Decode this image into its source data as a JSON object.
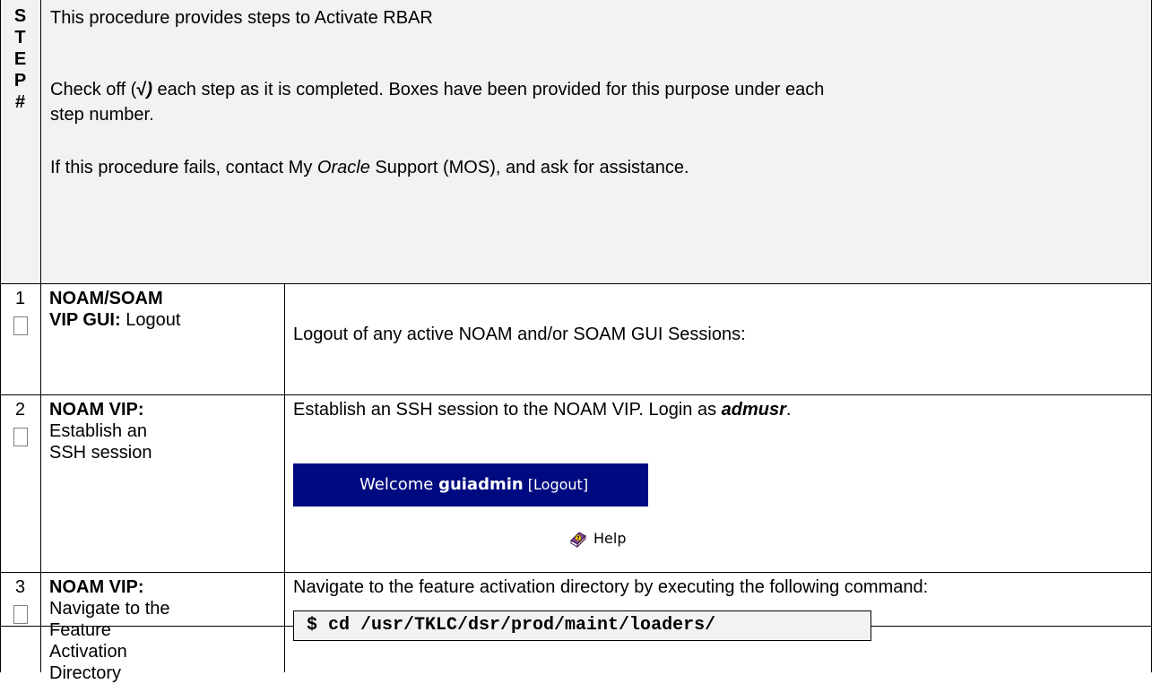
{
  "header": {
    "step_label": [
      "S",
      "T",
      "E",
      "P",
      "#"
    ],
    "intro": "This procedure provides steps to Activate RBAR",
    "check_pre": "Check off (",
    "check_mark": "√",
    "check_paren": ")",
    "check_post": " each step as it is completed. Boxes have been provided for this purpose under each",
    "check_line2": "step number.",
    "fail_pre": "If this procedure fails, contact My ",
    "fail_oracle": "Oracle",
    "fail_post": " Support (MOS), and ask for assistance."
  },
  "steps": [
    {
      "number": "1",
      "title_bold_1": "NOAM/SOAM",
      "title_bold_2": "VIP GUI:",
      "title_rest": " Logout",
      "instruction": "Logout of any active NOAM and/or SOAM GUI Sessions:",
      "welcome_prefix": "Welcome ",
      "welcome_user": "guiadmin",
      "welcome_logout": " [Logout]",
      "help_label": "Help",
      "help_icon": "help-book-icon"
    },
    {
      "number": "2",
      "title_bold": "NOAM VIP:",
      "title_line2": "Establish an",
      "title_line3": "SSH session",
      "instruction_pre": "Establish an SSH session to the NOAM VIP. Login as ",
      "instruction_user": "admusr",
      "instruction_post": "."
    },
    {
      "number": "3",
      "title_bold": "NOAM VIP:",
      "title_line2": "Navigate to the",
      "title_line3": "Feature",
      "title_line4": "Activation",
      "title_line5": "Directory",
      "instruction": "Navigate to the feature activation directory by executing the following command:",
      "command": "$ cd /usr/TKLC/dsr/prod/maint/loaders/"
    }
  ],
  "colors": {
    "header_bg": "#f2f2f2",
    "welcome_bar_bg": "#000a80",
    "command_bg": "#f2f2f2"
  }
}
